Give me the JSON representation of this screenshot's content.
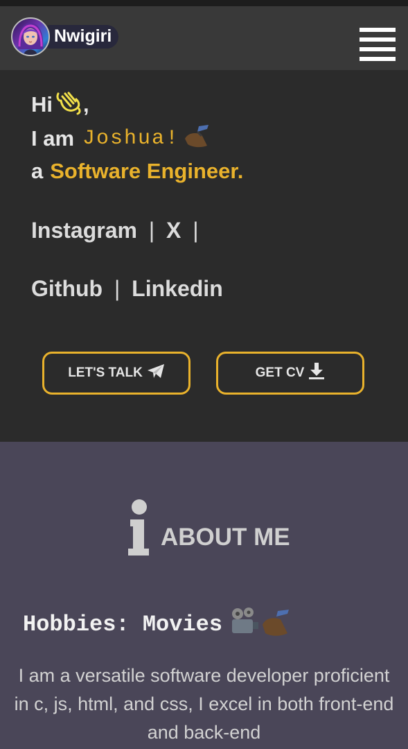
{
  "nav": {
    "brand_name": "Nwigiri",
    "menu_icon": "hamburger-icon"
  },
  "hero": {
    "greeting": "Hi",
    "greeting_emoji": "waving-hand-icon",
    "greeting_comma": ",",
    "intro_prefix": "I am",
    "name": "Joshua!",
    "name_emoji": "writing-hand-icon",
    "role_prefix": "a",
    "role": "Software Engineer.",
    "social_line1": [
      {
        "label": "Instagram"
      },
      {
        "label": "X"
      }
    ],
    "social_line2": [
      {
        "label": "Github"
      },
      {
        "label": "Linkedin"
      }
    ],
    "separator": "|",
    "talk_button": "LET'S TALK",
    "talk_icon": "paper-plane-icon",
    "cv_button": "GET CV",
    "cv_icon": "download-icon"
  },
  "about": {
    "icon": "info-icon",
    "title": "ABOUT ME",
    "hobbies_label": "Hobbies: Movies",
    "hobbies_emoji": "movie-projector-icon",
    "description": "I am a versatile software developer proficient in c, js, html, and css, I excel in both front-end and back-end"
  },
  "colors": {
    "accent": "#e9b22c",
    "hero_bg": "#2b2b2b",
    "nav_bg": "#393939",
    "about_bg": "#4a4658"
  }
}
